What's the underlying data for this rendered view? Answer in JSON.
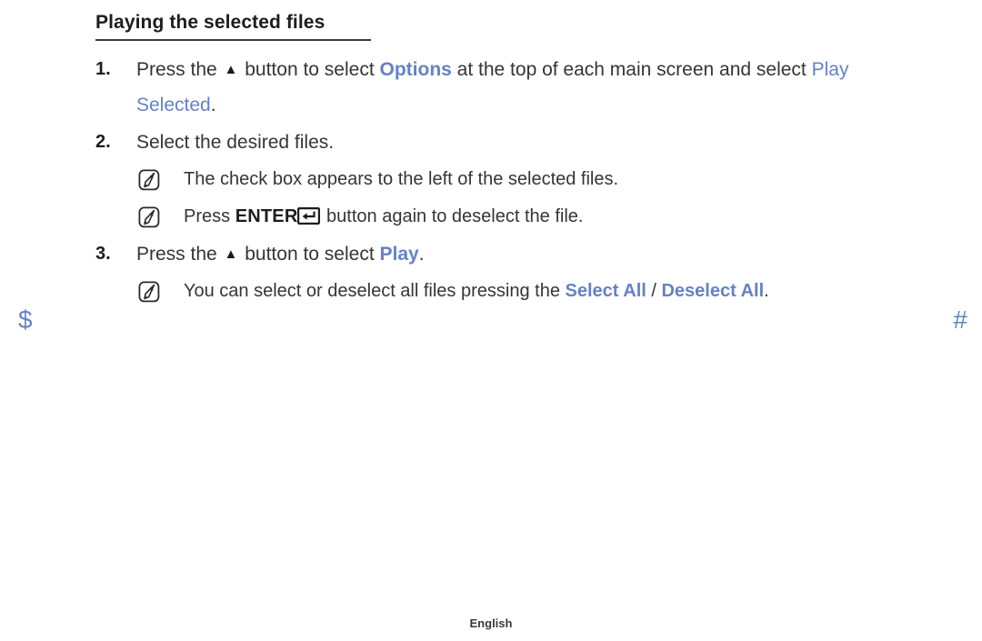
{
  "heading": {
    "title": "Playing the selected files"
  },
  "steps": [
    {
      "number": "1.",
      "segments": [
        {
          "type": "text",
          "value": "Press the "
        },
        {
          "type": "icon",
          "value": "▲",
          "name": "up-arrow-glyph"
        },
        {
          "type": "text",
          "value": " button to select "
        },
        {
          "type": "blue-bold",
          "value": "Options"
        },
        {
          "type": "text",
          "value": " at the top of each main screen and select "
        },
        {
          "type": "blue",
          "value": "Play Selected"
        },
        {
          "type": "text",
          "value": "."
        }
      ]
    },
    {
      "number": "2.",
      "segments": [
        {
          "type": "text",
          "value": "Select the desired files."
        }
      ]
    },
    {
      "number": "3.",
      "segments": [
        {
          "type": "text",
          "value": "Press the "
        },
        {
          "type": "icon",
          "value": "▲",
          "name": "up-arrow-glyph"
        },
        {
          "type": "text",
          "value": " button to select "
        },
        {
          "type": "blue-bold",
          "value": "Play"
        },
        {
          "type": "text",
          "value": "."
        }
      ]
    }
  ],
  "notes": {
    "note1": {
      "icon": "note-pencil-icon",
      "text": "The check box appears to the left of the selected files."
    },
    "note2": {
      "icon": "note-pencil-icon",
      "prefix": "Press ",
      "key_label": "ENTER",
      "key_glyph": "enter-key-icon",
      "suffix": " button again to deselect the file."
    },
    "note3": {
      "icon": "note-pencil-icon",
      "prefix": "You can select or deselect all files pressing the ",
      "link1": "Select All",
      "separator": " / ",
      "link2": "Deselect All",
      "suffix": "."
    }
  },
  "markers": {
    "left": "$",
    "right": "#"
  },
  "footer": {
    "language": "English"
  },
  "colors": {
    "accent_blue": "#6682c4",
    "body_text": "#353535",
    "heading_text": "#1d1d1d",
    "rule": "#3c3c3c"
  }
}
